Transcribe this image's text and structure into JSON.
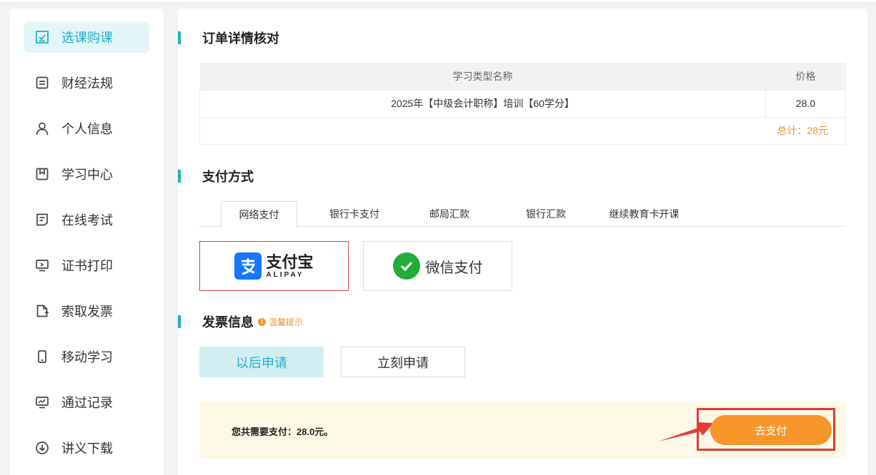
{
  "sidebar": {
    "items": [
      {
        "label": "选课购课",
        "icon": "checkbox-icon",
        "active": true
      },
      {
        "label": "财经法规",
        "icon": "document-icon"
      },
      {
        "label": "个人信息",
        "icon": "user-icon"
      },
      {
        "label": "学习中心",
        "icon": "bookmark-icon"
      },
      {
        "label": "在线考试",
        "icon": "exam-icon"
      },
      {
        "label": "证书打印",
        "icon": "monitor-icon"
      },
      {
        "label": "索取发票",
        "icon": "file-add-icon"
      },
      {
        "label": "移动学习",
        "icon": "mobile-icon"
      },
      {
        "label": "通过记录",
        "icon": "chart-icon"
      },
      {
        "label": "讲义下载",
        "icon": "download-icon"
      }
    ]
  },
  "order": {
    "title": "订单详情核对",
    "col_name": "学习类型名称",
    "col_price": "价格",
    "rows": [
      {
        "name": "2025年【中级会计职称】培训【60学分】",
        "price": "28.0"
      }
    ],
    "total": "总计：28元"
  },
  "payment": {
    "title": "支付方式",
    "tabs": [
      "网络支付",
      "银行卡支付",
      "邮局汇款",
      "银行汇款",
      "继续教育卡开课"
    ],
    "alipay_cn": "支付宝",
    "alipay_en": "ALIPAY",
    "wechat": "微信支付"
  },
  "invoice": {
    "title": "发票信息",
    "tip": "温馨提示",
    "later": "以后申请",
    "now": "立刻申请"
  },
  "paybar": {
    "amount_text": "您共需要支付：28.0元。",
    "go_pay": "去支付"
  },
  "colors": {
    "accent": "#1fb1c6",
    "orange": "#f7962b",
    "highlight": "#e53935"
  }
}
